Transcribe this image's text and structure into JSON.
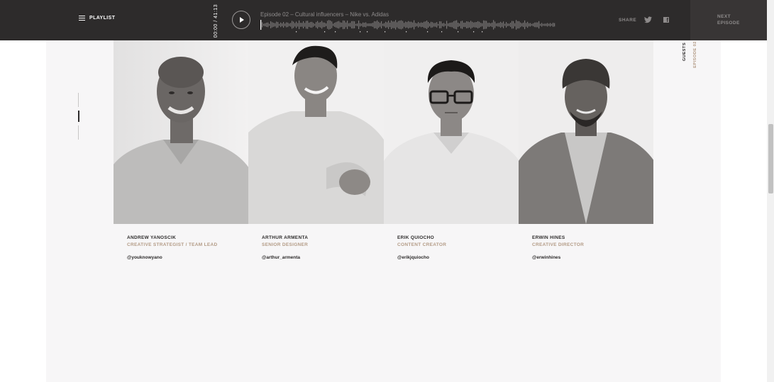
{
  "player": {
    "playlist_label": "PLAYLIST",
    "time": "00:00 / 41:13",
    "episode_title": "Episode 02 – Cultural influencers – Nike vs. Adidas",
    "share_label": "SHARE",
    "next_line1": "NEXT",
    "next_line2": "EPISODE"
  },
  "side": {
    "guests_label": "GUESTS",
    "episode_label": "EPISODE 02"
  },
  "guests": [
    {
      "name": "ANDREW YANOSCIK",
      "role": "CREATIVE STRATEGIST / TEAM LEAD",
      "handle": "@youknowyano"
    },
    {
      "name": "ARTHUR ARMENTA",
      "role": "SENIOR DESIGNER",
      "handle": "@arthur_armenta"
    },
    {
      "name": "ERIK QUIOCHO",
      "role": "CONTENT CREATOR",
      "handle": "@erikjquiocho"
    },
    {
      "name": "ERWIN HINES",
      "role": "CREATIVE DIRECTOR",
      "handle": "@erwinhines"
    }
  ],
  "colors": {
    "bar": "#2d2b2b",
    "accent": "#b39b86",
    "background": "#f7f6f7"
  },
  "icons": [
    "playlist-icon",
    "play-icon",
    "twitter-icon",
    "facebook-icon"
  ]
}
